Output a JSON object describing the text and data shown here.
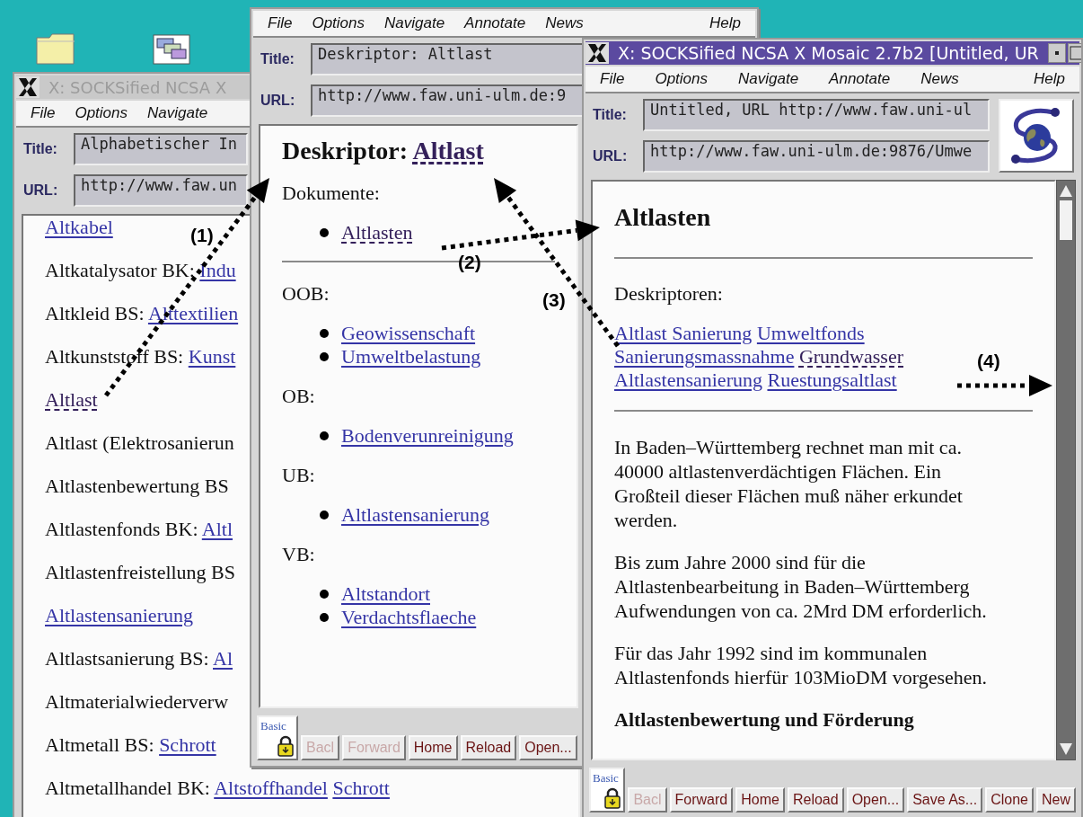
{
  "desktop": {
    "icons": [
      {
        "kind": "folder"
      },
      {
        "kind": "windows"
      }
    ]
  },
  "windows": [
    {
      "title": "X: SOCKSified NCSA X",
      "active": false,
      "menu": [
        {
          "label": "File"
        },
        {
          "label": "Options"
        },
        {
          "label": "Navigate"
        }
      ],
      "title_label": "Title:",
      "title_field": "Alphabetischer In",
      "url_label": "URL:",
      "url_field": "http://www.faw.un",
      "blocks": [
        {
          "kind": "line",
          "parts": [
            {
              "text": "Altkabel",
              "link": true,
              "visited": false
            }
          ]
        },
        {
          "kind": "line",
          "parts": [
            {
              "text": "Altkatalysator BK:",
              "link": false
            },
            {
              "text": "Indu",
              "link": true,
              "visited": false
            }
          ]
        },
        {
          "kind": "line",
          "parts": [
            {
              "text": "Altkleid BS:",
              "link": false
            },
            {
              "text": "Alttextilien",
              "link": true,
              "visited": false
            }
          ]
        },
        {
          "kind": "line",
          "parts": [
            {
              "text": "Altkunststoff BS:",
              "link": false
            },
            {
              "text": "Kunst",
              "link": true,
              "visited": false
            }
          ]
        },
        {
          "kind": "line",
          "parts": [
            {
              "text": "Altlast",
              "link": true,
              "visited": true
            }
          ]
        },
        {
          "kind": "line",
          "parts": [
            {
              "text": "Altlast (Elektrosanierun",
              "link": false
            }
          ]
        },
        {
          "kind": "line",
          "parts": [
            {
              "text": "Altlastenbewertung BS",
              "link": false
            }
          ]
        },
        {
          "kind": "line",
          "parts": [
            {
              "text": "Altlastenfonds BK:",
              "link": false
            },
            {
              "text": "Altl",
              "link": true,
              "visited": false
            }
          ]
        },
        {
          "kind": "line",
          "parts": [
            {
              "text": "Altlastenfreistellung BS",
              "link": false
            }
          ]
        },
        {
          "kind": "line",
          "parts": [
            {
              "text": "Altlastensanierung",
              "link": true,
              "visited": false
            }
          ]
        },
        {
          "kind": "line",
          "parts": [
            {
              "text": "Altlastsanierung BS:",
              "link": false
            },
            {
              "text": "Al",
              "link": true,
              "visited": false
            }
          ]
        },
        {
          "kind": "line",
          "parts": [
            {
              "text": "Altmaterialwiederverw",
              "link": false
            }
          ]
        },
        {
          "kind": "line",
          "parts": [
            {
              "text": "Altmetall BS:",
              "link": false
            },
            {
              "text": "Schrott",
              "link": true,
              "visited": false
            }
          ]
        },
        {
          "kind": "line",
          "parts": [
            {
              "text": "Altmetallhandel BK:",
              "link": false
            },
            {
              "text": "Altstoffhandel",
              "link": true,
              "visited": false
            },
            {
              "text": "Schrott",
              "link": true,
              "visited": false
            }
          ]
        }
      ]
    },
    {
      "menu": [
        {
          "label": "File"
        },
        {
          "label": "Options"
        },
        {
          "label": "Navigate"
        },
        {
          "label": "Annotate"
        },
        {
          "label": "News"
        },
        {
          "label": "Help",
          "right": true
        }
      ],
      "title_label": "Title:",
      "title_field": "Deskriptor: Altlast",
      "url_label": "URL:",
      "url_field": "http://www.faw.uni-ulm.de:9",
      "blocks": [
        {
          "kind": "heading",
          "parts": [
            {
              "text": "Deskriptor:",
              "link": false
            },
            {
              "text": "Altlast",
              "link": true,
              "visited": true
            }
          ]
        },
        {
          "kind": "label",
          "text": "Dokumente:"
        },
        {
          "kind": "bullets",
          "items": [
            {
              "text": "Altlasten",
              "visited": true
            }
          ]
        },
        {
          "kind": "rule"
        },
        {
          "kind": "label",
          "text": "OOB:"
        },
        {
          "kind": "bullets",
          "items": [
            {
              "text": "Geowissenschaft",
              "visited": false
            },
            {
              "text": "Umweltbelastung",
              "visited": false
            }
          ]
        },
        {
          "kind": "label",
          "text": "OB:"
        },
        {
          "kind": "bullets",
          "items": [
            {
              "text": "Bodenverunreinigung",
              "visited": false
            }
          ]
        },
        {
          "kind": "label",
          "text": "UB:"
        },
        {
          "kind": "bullets",
          "items": [
            {
              "text": "Altlastensanierung",
              "visited": false
            }
          ]
        },
        {
          "kind": "label",
          "text": "VB:"
        },
        {
          "kind": "bullets",
          "items": [
            {
              "text": "Altstandort",
              "visited": false
            },
            {
              "text": "Verdachtsflaeche",
              "visited": false
            }
          ]
        }
      ],
      "toolbar": {
        "mode": "Basic",
        "buttons": [
          {
            "label": "Bacl",
            "disabled": true
          },
          {
            "label": "Forward",
            "disabled": true
          },
          {
            "label": "Home",
            "disabled": false
          },
          {
            "label": "Reload",
            "disabled": false
          },
          {
            "label": "Open...",
            "disabled": false
          }
        ]
      }
    },
    {
      "title": "X: SOCKSified NCSA X Mosaic 2.7b2 [Untitled, UR",
      "active": true,
      "logo": true,
      "scrollbar": true,
      "menu": [
        {
          "label": "File"
        },
        {
          "label": "Options"
        },
        {
          "label": "Navigate"
        },
        {
          "label": "Annotate"
        },
        {
          "label": "News"
        },
        {
          "label": "Help",
          "right": true
        }
      ],
      "title_label": "Title:",
      "title_field": "Untitled, URL http://www.faw.uni-ul",
      "url_label": "URL:",
      "url_field": "http://www.faw.uni-ulm.de:9876/Umwe",
      "blocks": [
        {
          "kind": "heading",
          "parts": [
            {
              "text": "Altlasten",
              "link": false
            }
          ]
        },
        {
          "kind": "rule"
        },
        {
          "kind": "label",
          "text": "Deskriptoren:"
        },
        {
          "kind": "line",
          "tight": true,
          "parts": [
            {
              "text": "Altlast Sanierung",
              "link": true,
              "visited": false
            },
            {
              "text": "Umweltfonds",
              "link": true,
              "visited": false
            }
          ]
        },
        {
          "kind": "line",
          "tight": true,
          "parts": [
            {
              "text": "Sanierungsmassnahme",
              "link": true,
              "visited": false
            },
            {
              "text": "Grundwasser",
              "link": true,
              "visited": true
            }
          ]
        },
        {
          "kind": "line",
          "tight": true,
          "parts": [
            {
              "text": "Altlastensanierung",
              "link": true,
              "visited": false
            },
            {
              "text": "Ruestungsaltlast",
              "link": true,
              "visited": false
            }
          ]
        },
        {
          "kind": "rule"
        },
        {
          "kind": "paragraph",
          "text": "In Baden–Württemberg rechnet man mit ca. 40000 altlastenverdächtigen Flächen. Ein Großteil dieser Flächen muß näher erkundet werden."
        },
        {
          "kind": "paragraph",
          "text": "Bis zum Jahre 2000 sind für die Altlastenbearbeitung in Baden–Württemberg Aufwendungen von ca. 2Mrd DM erforderlich."
        },
        {
          "kind": "paragraph",
          "text": "Für das Jahr 1992 sind im kommunalen Altlastenfonds hierfür 103MioDM vorgesehen."
        },
        {
          "kind": "subheading",
          "text": "Altlastenbewertung und Förderung"
        }
      ],
      "toolbar": {
        "mode": "Basic",
        "buttons": [
          {
            "label": "Bacl",
            "disabled": true
          },
          {
            "label": "Forward",
            "disabled": false
          },
          {
            "label": "Home",
            "disabled": false
          },
          {
            "label": "Reload",
            "disabled": false
          },
          {
            "label": "Open...",
            "disabled": false
          },
          {
            "label": "Save As...",
            "disabled": false
          },
          {
            "label": "Clone",
            "disabled": false
          },
          {
            "label": "New",
            "disabled": false
          }
        ]
      }
    }
  ],
  "annotations": [
    {
      "label": "(1)"
    },
    {
      "label": "(2)"
    },
    {
      "label": "(3)"
    },
    {
      "label": "(4)"
    }
  ]
}
